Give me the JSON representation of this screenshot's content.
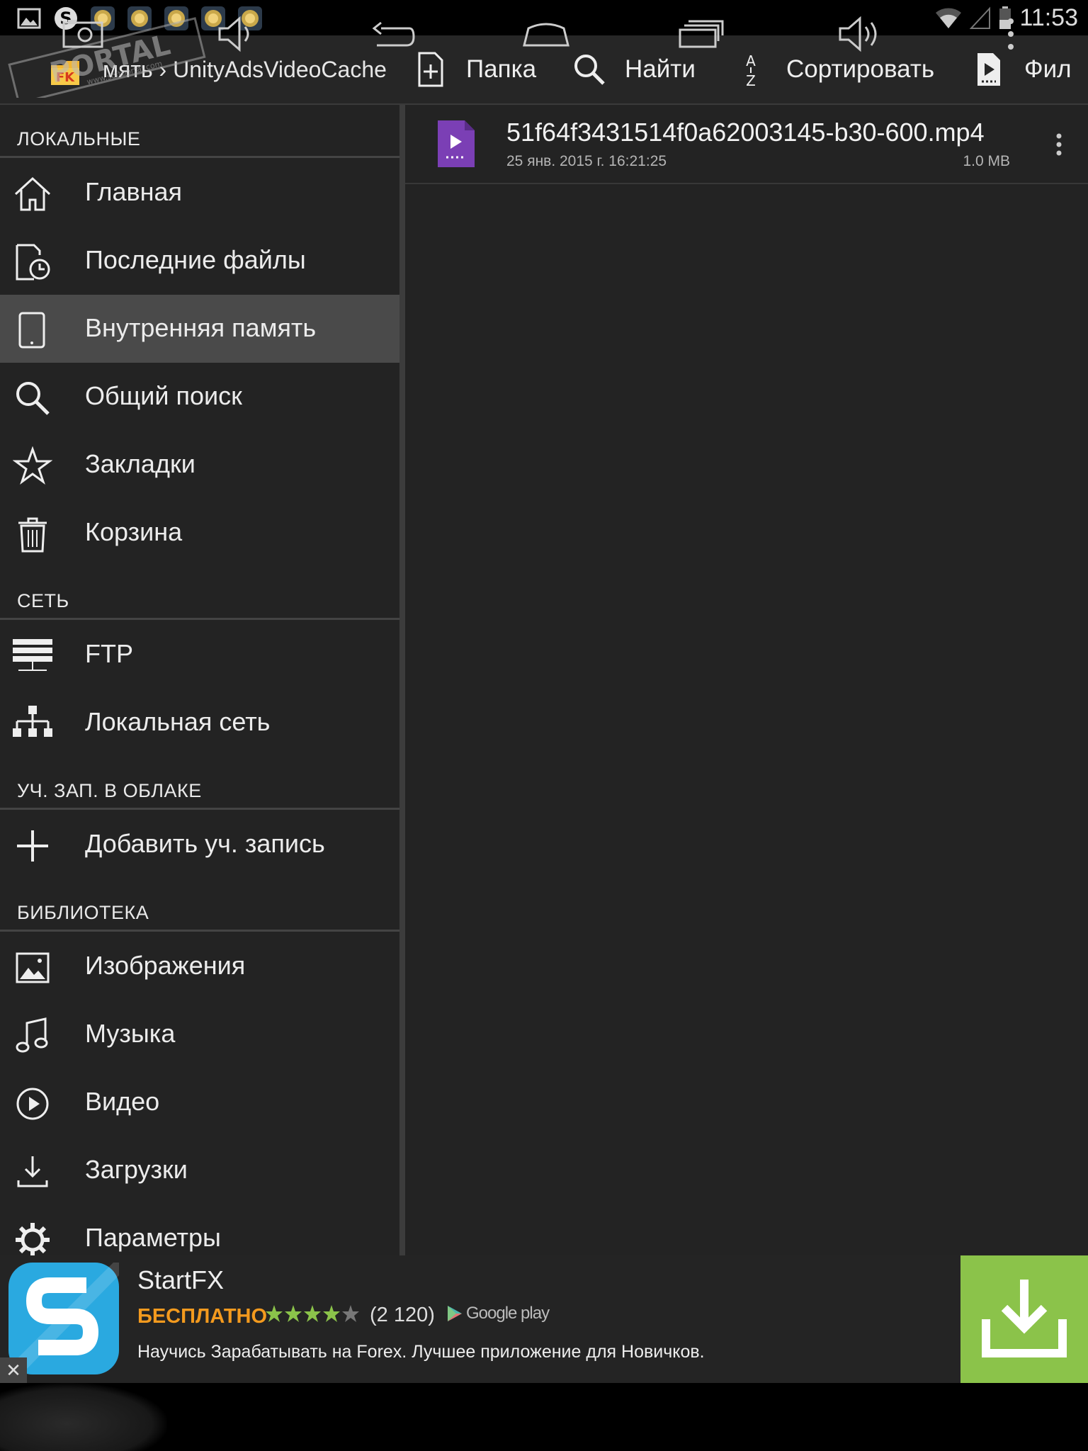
{
  "status_bar": {
    "time": "11:53"
  },
  "watermark": {
    "text": "PORTAL",
    "subtext": "www.softportal.com"
  },
  "action_bar": {
    "breadcrumb": "мять › UnityAdsVideoCache",
    "actions": {
      "folder": "Папка",
      "find": "Найти",
      "sort": "Сортировать",
      "filter": "Фил"
    }
  },
  "sidebar": {
    "sections": {
      "local": "ЛОКАЛЬНЫЕ",
      "network": "СЕТЬ",
      "cloud": "УЧ. ЗАП. В ОБЛАКЕ",
      "library": "БИБЛИОТЕКА"
    },
    "items": {
      "home": "Главная",
      "recent": "Последние файлы",
      "internal": "Внутренняя память",
      "search": "Общий поиск",
      "bookmarks": "Закладки",
      "trash": "Корзина",
      "ftp": "FTP",
      "lan": "Локальная сеть",
      "add_account": "Добавить уч. запись",
      "images": "Изображения",
      "music": "Музыка",
      "video": "Видео",
      "downloads": "Загрузки",
      "settings": "Параметры"
    }
  },
  "files": [
    {
      "name": "51f64f3431514f0a62003145-b30-600.mp4",
      "date": "25 янв. 2015 г. 16:21:25",
      "size": "1.0 MB"
    }
  ],
  "ad": {
    "title": "StartFX",
    "price": "БЕСПЛАТНО",
    "rating_count": "(2 120)",
    "rating": 4,
    "store": "Google play",
    "description": "Научись Зарабатывать на Forex. Лучшее приложение для Новичков.",
    "close": "✕"
  },
  "colors": {
    "accent_video": "#7b3fb5",
    "ad_download": "#8bc34a",
    "ad_price": "#f39a1e",
    "ad_icon": "#2aa9e0"
  }
}
